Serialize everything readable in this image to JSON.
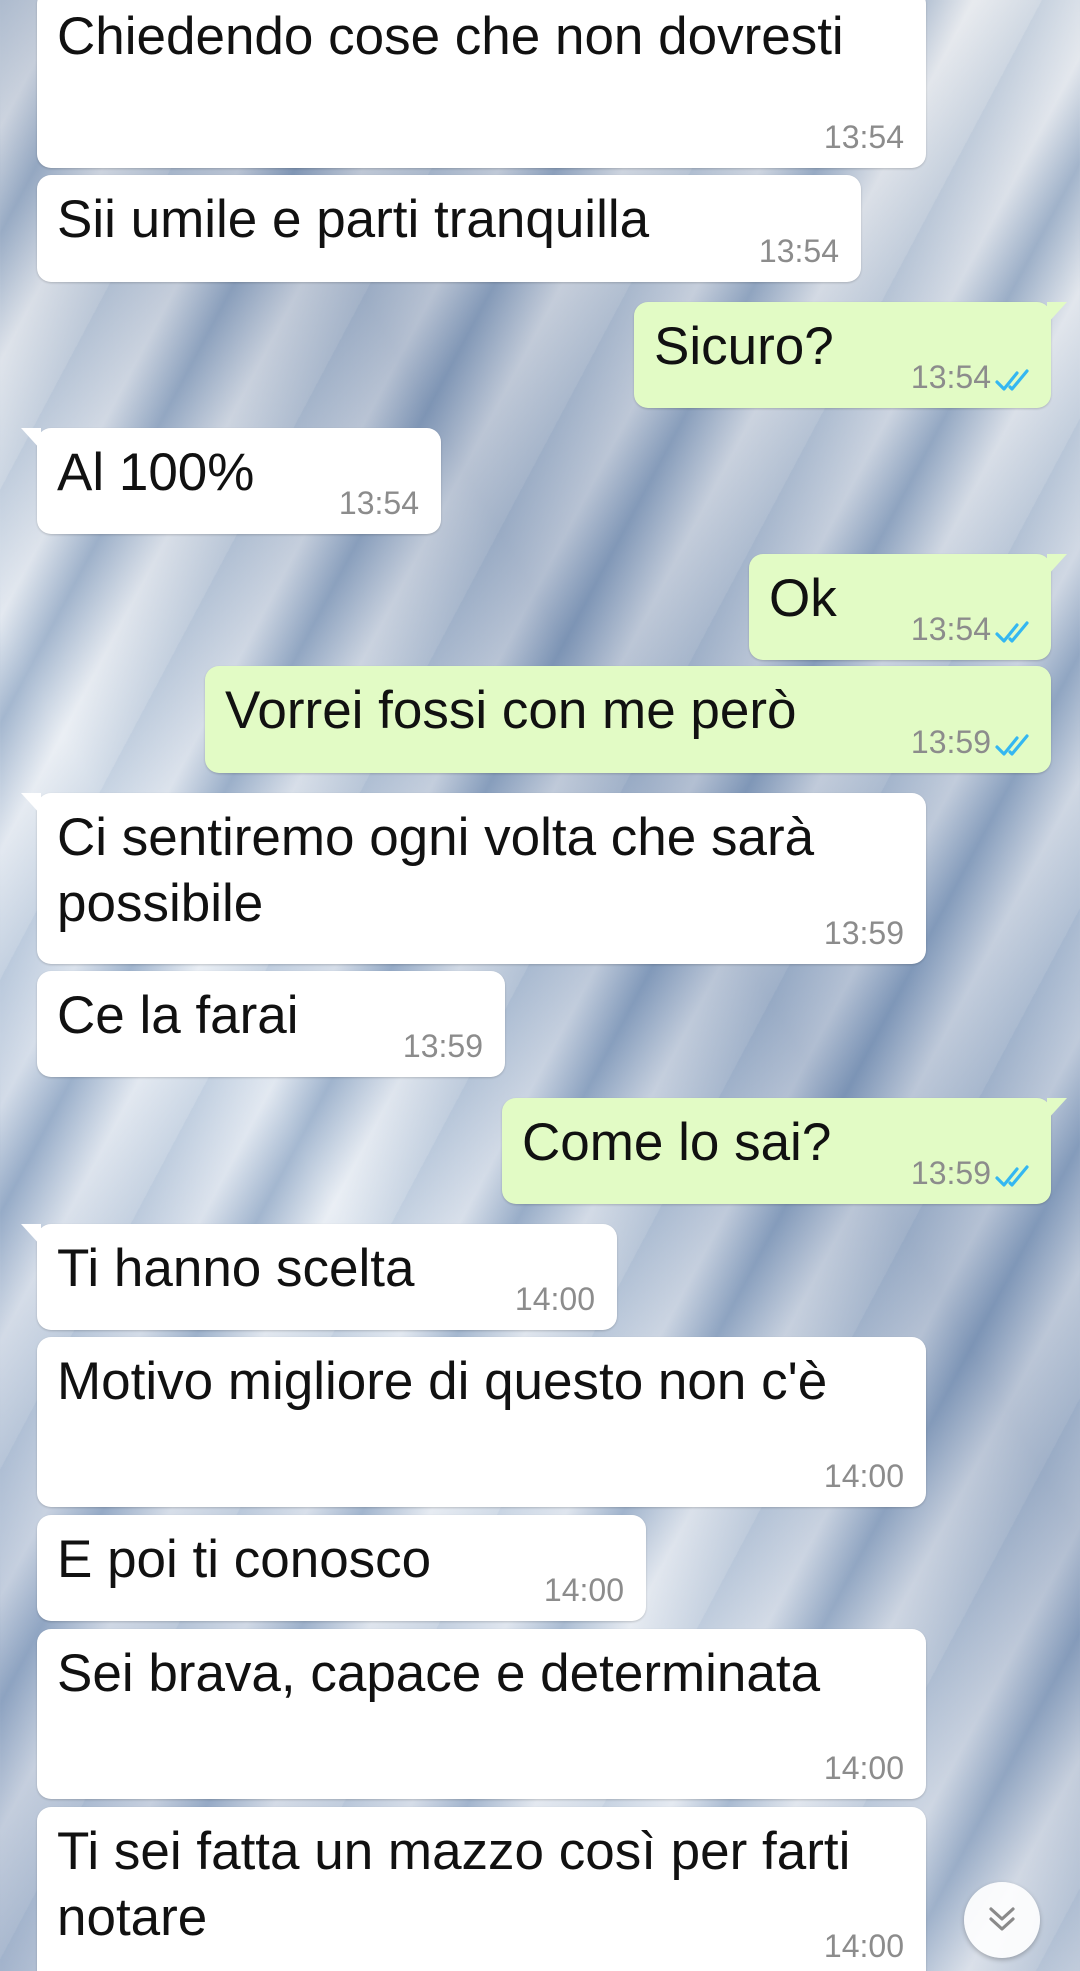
{
  "messages": [
    {
      "dir": "in",
      "text": "Chiedendo cose che non dovresti",
      "time": "13:54",
      "read": false,
      "tail": false
    },
    {
      "dir": "in",
      "text": "Sii umile e parti tranquilla",
      "time": "13:54",
      "read": false,
      "tail": false
    },
    {
      "dir": "out",
      "text": "Sicuro?",
      "time": "13:54",
      "read": true,
      "tail": true
    },
    {
      "dir": "in",
      "text": "Al 100%",
      "time": "13:54",
      "read": false,
      "tail": true
    },
    {
      "dir": "out",
      "text": "Ok",
      "time": "13:54",
      "read": true,
      "tail": true
    },
    {
      "dir": "out",
      "text": "Vorrei fossi con me però",
      "time": "13:59",
      "read": true,
      "tail": false
    },
    {
      "dir": "in",
      "text": "Ci sentiremo ogni volta che sarà\npossibile",
      "time": "13:59",
      "read": false,
      "tail": true
    },
    {
      "dir": "in",
      "text": "Ce la farai",
      "time": "13:59",
      "read": false,
      "tail": false
    },
    {
      "dir": "out",
      "text": "Come lo sai?",
      "time": "13:59",
      "read": true,
      "tail": true
    },
    {
      "dir": "in",
      "text": "Ti hanno scelta",
      "time": "14:00",
      "read": false,
      "tail": true
    },
    {
      "dir": "in",
      "text": "Motivo migliore di questo non c'è",
      "time": "14:00",
      "read": false,
      "tail": false
    },
    {
      "dir": "in",
      "text": "E poi ti conosco",
      "time": "14:00",
      "read": false,
      "tail": false
    },
    {
      "dir": "in",
      "text": "Sei brava, capace e determinata",
      "time": "14:00",
      "read": false,
      "tail": false
    },
    {
      "dir": "in",
      "text": "Ti sei fatta un mazzo così per farti\nnotare",
      "time": "14:00",
      "read": false,
      "tail": false
    }
  ],
  "icons": {
    "read_receipt": "double-check-icon",
    "scroll_down": "double-chevron-down-icon"
  },
  "colors": {
    "incoming_bubble": "#ffffff",
    "outgoing_bubble": "#e2fbc5",
    "read_tick": "#34b7f1",
    "timestamp": "#8c8c8c"
  }
}
